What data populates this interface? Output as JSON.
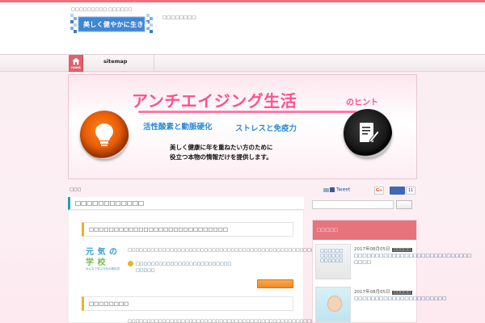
{
  "header": {
    "tagline": "□□□□□□□□□ □□□□□□",
    "logo_text": "美しく健やかに生きる",
    "note": "□□□□□□□□"
  },
  "nav": {
    "home_label": "HOME",
    "sitemap_label": "sitemap"
  },
  "hero": {
    "title": "アンチエイジング生活",
    "title_small": "のヒント",
    "subtitle_1": "活性酸素と動脈硬化",
    "subtitle_2": "ストレスと免疫力",
    "desc_1": "美しく健康に年を重ねたい方のために",
    "desc_2": "役立つ本物の情報だけを提供します。"
  },
  "main": {
    "breadcrumb": "□□□",
    "section_title": "□□□□□□□□□□□□",
    "article_1": {
      "heading": "□□□□□□□□□□□□□□□□□□□□□□□□□□□□",
      "thumb_line1": "元 気 の",
      "thumb_line2": "学 校",
      "thumb_caption": "みんなで学ぶ元気の教科書",
      "excerpt": "□□□□□□□□□□□□□□□□□□□□□□□□□□□□□□□□□□□□□□□□□□□□□□□□□□□□□□□□□□□□□□□□□□□□□□□□□□",
      "link_1": "□□□□□□□□□□□□□□□□□□□□□□□□□",
      "link_2": "□□□□□",
      "more_button": ""
    },
    "article_2": {
      "heading": "□□□□□□□□",
      "excerpt": "□□□□□□□□□□□□□□□□□□□□□□□□□□□□□□□□□□□□□□□□□□□□□□□□□□□□"
    }
  },
  "sidebar": {
    "tweet_label": "Tweet",
    "gplus_label": "G+",
    "fb_count": "11",
    "search_placeholder": "",
    "widget_title": "□□□□□",
    "posts": [
      {
        "date": "2017年08月05日",
        "category": "□□□□□",
        "title": "□□□□□□□□□□□□□□□□□□□□□□□□□□□□ □□□□",
        "thumb_text": "□□□□□□\n□□□□□□\n□□□□□□"
      },
      {
        "date": "2017年08月05日",
        "category": "□□□□□",
        "title": "□□□□□□□□□□□□□□□□□□□□□□"
      }
    ]
  },
  "colors": {
    "accent_red": "#e7737d",
    "accent_teal": "#1fa2b4",
    "accent_gold": "#e8b32a",
    "hero_pink": "#ff4f8d",
    "hero_blue": "#2a8ad6"
  }
}
